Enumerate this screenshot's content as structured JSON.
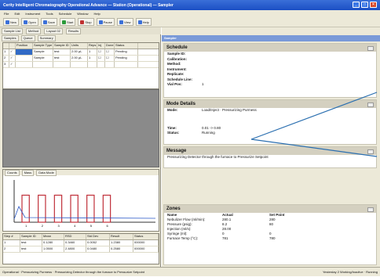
{
  "window": {
    "title": "Cerity Intelligent Chromatography Operational Advance — Station (Operational) — Sampler"
  },
  "menu": [
    "File",
    "Edit",
    "Instrument",
    "Tools",
    "Schedule",
    "Window",
    "Help"
  ],
  "toolbar": {
    "new": "New",
    "open": "Open",
    "save": "Save",
    "start": "Start",
    "stop": "Stop",
    "pause": "Pause",
    "view": "View",
    "help": "Help"
  },
  "left": {
    "subtabs": [
      "Sample List",
      "Method",
      "Layout 02",
      "Results"
    ],
    "tabs": [
      "Samples",
      "Queue",
      "Summary"
    ],
    "grid": {
      "headers": [
        "",
        "",
        "Position",
        "Sample Type",
        "Sample ID",
        "Units",
        "Reps",
        "Inj",
        "Done",
        "Status"
      ],
      "rows": [
        [
          "1",
          "✓",
          "",
          "Sample",
          "test",
          "2.00 µL",
          "1",
          "☐",
          "☐",
          "Pending"
        ],
        [
          "2",
          "✓",
          "",
          "Sample",
          "test",
          "2.00 µL",
          "1",
          "☐",
          "☐",
          "Pending"
        ],
        [
          "3",
          "✓",
          "",
          "",
          "",
          "",
          "",
          "",
          "",
          ""
        ]
      ]
    },
    "chart_tabs": [
      "Counts",
      "Mass",
      "Data Mode"
    ],
    "results": {
      "headers": [
        "Step #",
        "Sample ID",
        "Mean",
        "RSD",
        "Std Dev",
        "Result",
        "Status"
      ],
      "rows": [
        [
          "1",
          "test",
          "0.1280",
          "0.3460",
          "0.0052",
          "1.2380",
          "000000"
        ],
        [
          "2",
          "test",
          "1.0500",
          "2.4800",
          "0.0480",
          "0.2580",
          "000000"
        ]
      ]
    }
  },
  "right": {
    "header": "Sampler",
    "schedule": {
      "title": "Schedule",
      "fields": [
        {
          "k": "Sample ID:",
          "v": ""
        },
        {
          "k": "Calibration:",
          "v": ""
        },
        {
          "k": "Method:",
          "v": ""
        },
        {
          "k": "Instrument:",
          "v": ""
        },
        {
          "k": "Replicate:",
          "v": ""
        },
        {
          "k": "Schedule Line:",
          "v": ""
        },
        {
          "k": "Vial Pos:",
          "v": "1"
        }
      ]
    },
    "mode": {
      "title": "Mode Details",
      "mode_k": "Mode:",
      "mode_v": "Load/Inject · Pressurizing Purmess",
      "time_k": "Time:",
      "time_v": "0.01 -> 0.80",
      "status_k": "Status:",
      "status_v": "Running"
    },
    "message": {
      "title": "Message",
      "text": "Pressurizing Detector through the furnace to Pressurize Setpoint"
    },
    "zones": {
      "title": "Zones",
      "headers": [
        "Name",
        "Actual",
        "Set Point"
      ],
      "rows": [
        [
          "Nebulizer Flow (ml/min):",
          "280.1",
          "280"
        ],
        [
          "Pressure (psig):",
          "8.2",
          "80"
        ],
        [
          "Injection (ml/s):",
          "28.00",
          ""
        ],
        [
          "Syringe (ml):",
          "0",
          "0"
        ],
        [
          "Furnace Temp (°C):",
          "781",
          "780"
        ]
      ]
    }
  },
  "status": {
    "left": "Operational · Pressurizing Purmess · Pressurizing Detector through the furnace to Pressurize Setpoint",
    "right": "Yesterday 2 Working/Inactive · Running"
  },
  "chart_data": {
    "type": "bar",
    "categories": [
      "1",
      "2",
      "3",
      "4",
      "5",
      "6"
    ],
    "values": [
      64,
      64,
      64,
      64,
      64,
      64
    ],
    "ylim": [
      0,
      100
    ]
  }
}
